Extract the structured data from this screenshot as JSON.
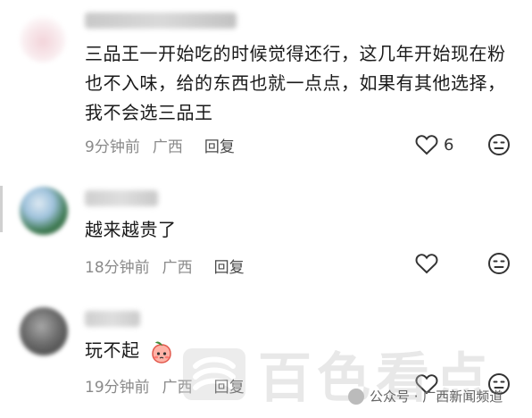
{
  "comments": [
    {
      "name": "大一 … 单国华 ( 怕 ) 惭",
      "lines": [
        "三品王一开始吃的时候觉得还行，这几年开始现在粉",
        "也不入味，给的东西也就一点点，如果有其他选择，",
        "我不会选三品王"
      ],
      "time": "9分钟前",
      "location": "广西",
      "reply": "回复",
      "likes": "6"
    },
    {
      "name": "",
      "lines": [
        "越来越贵了"
      ],
      "time": "18分钟前",
      "location": "广西",
      "reply": "回复",
      "likes": ""
    },
    {
      "name": "",
      "lines": [
        "玩不起"
      ],
      "time": "19分钟前",
      "location": "广西",
      "reply": "回复",
      "likes": ""
    }
  ],
  "watermark": {
    "text": "百色看点"
  },
  "footer": {
    "text": "公众号 · 广西新闻频道"
  },
  "icons": {
    "like": "heart-outline-icon",
    "react": "face-neutral-icon",
    "emoji": "peach-emoji"
  }
}
